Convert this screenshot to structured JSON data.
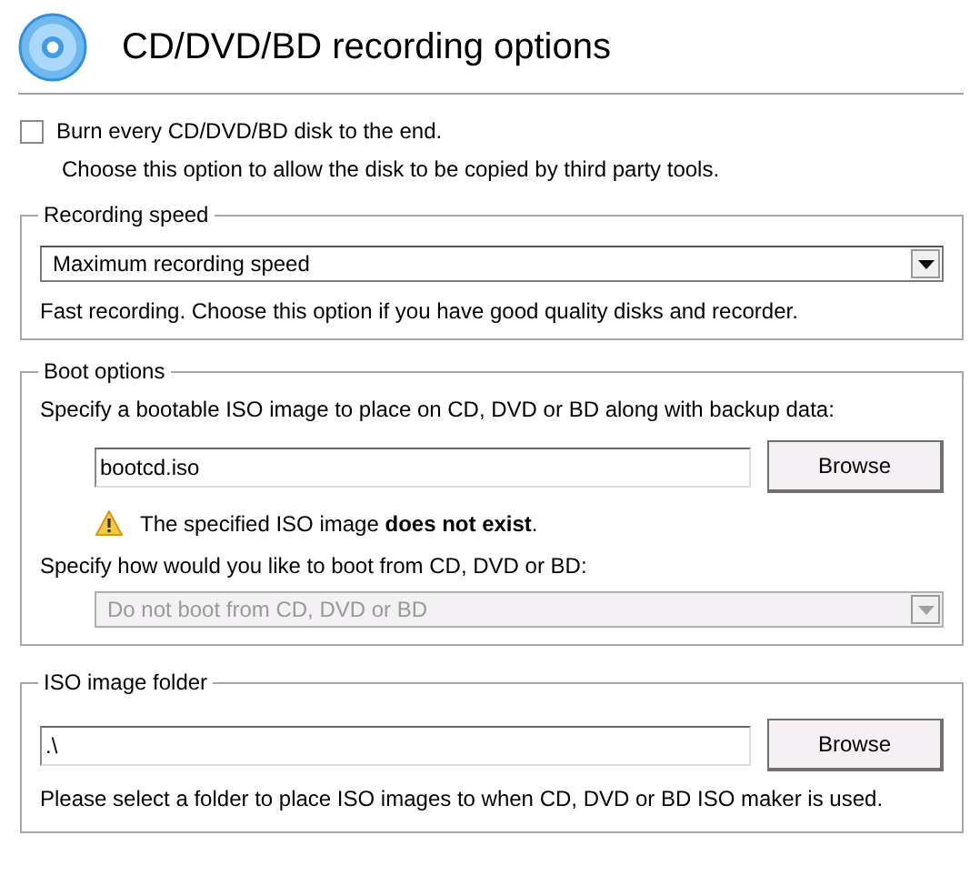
{
  "header": {
    "title": "CD/DVD/BD recording options"
  },
  "burn_option": {
    "label": "Burn every CD/DVD/BD disk to the end.",
    "checked": false,
    "description": "Choose this option to allow the disk to be copied by third party tools."
  },
  "recording_speed": {
    "legend": "Recording speed",
    "combo": {
      "value": "Maximum recording speed",
      "disabled": false
    },
    "description": "Fast recording. Choose this option if you have good quality disks and recorder."
  },
  "boot_options": {
    "legend": "Boot options",
    "prompt": "Specify a bootable ISO image to place on CD, DVD or BD along with backup data:",
    "field": {
      "value": "bootcd.iso"
    },
    "button": "Browse",
    "warning": "The specified ISO image **does not exist**.",
    "boot_prompt": "Specify how would you like to boot from CD, DVD or BD:",
    "combo": {
      "value": "Do not boot from CD, DVD or BD",
      "disabled": true
    }
  },
  "iso_image_folder": {
    "legend": "ISO image folder",
    "field": {
      "value": ".\\"
    },
    "button": "Browse",
    "description": "Please select a folder to place ISO images to when CD, DVD or BD ISO maker is used."
  }
}
